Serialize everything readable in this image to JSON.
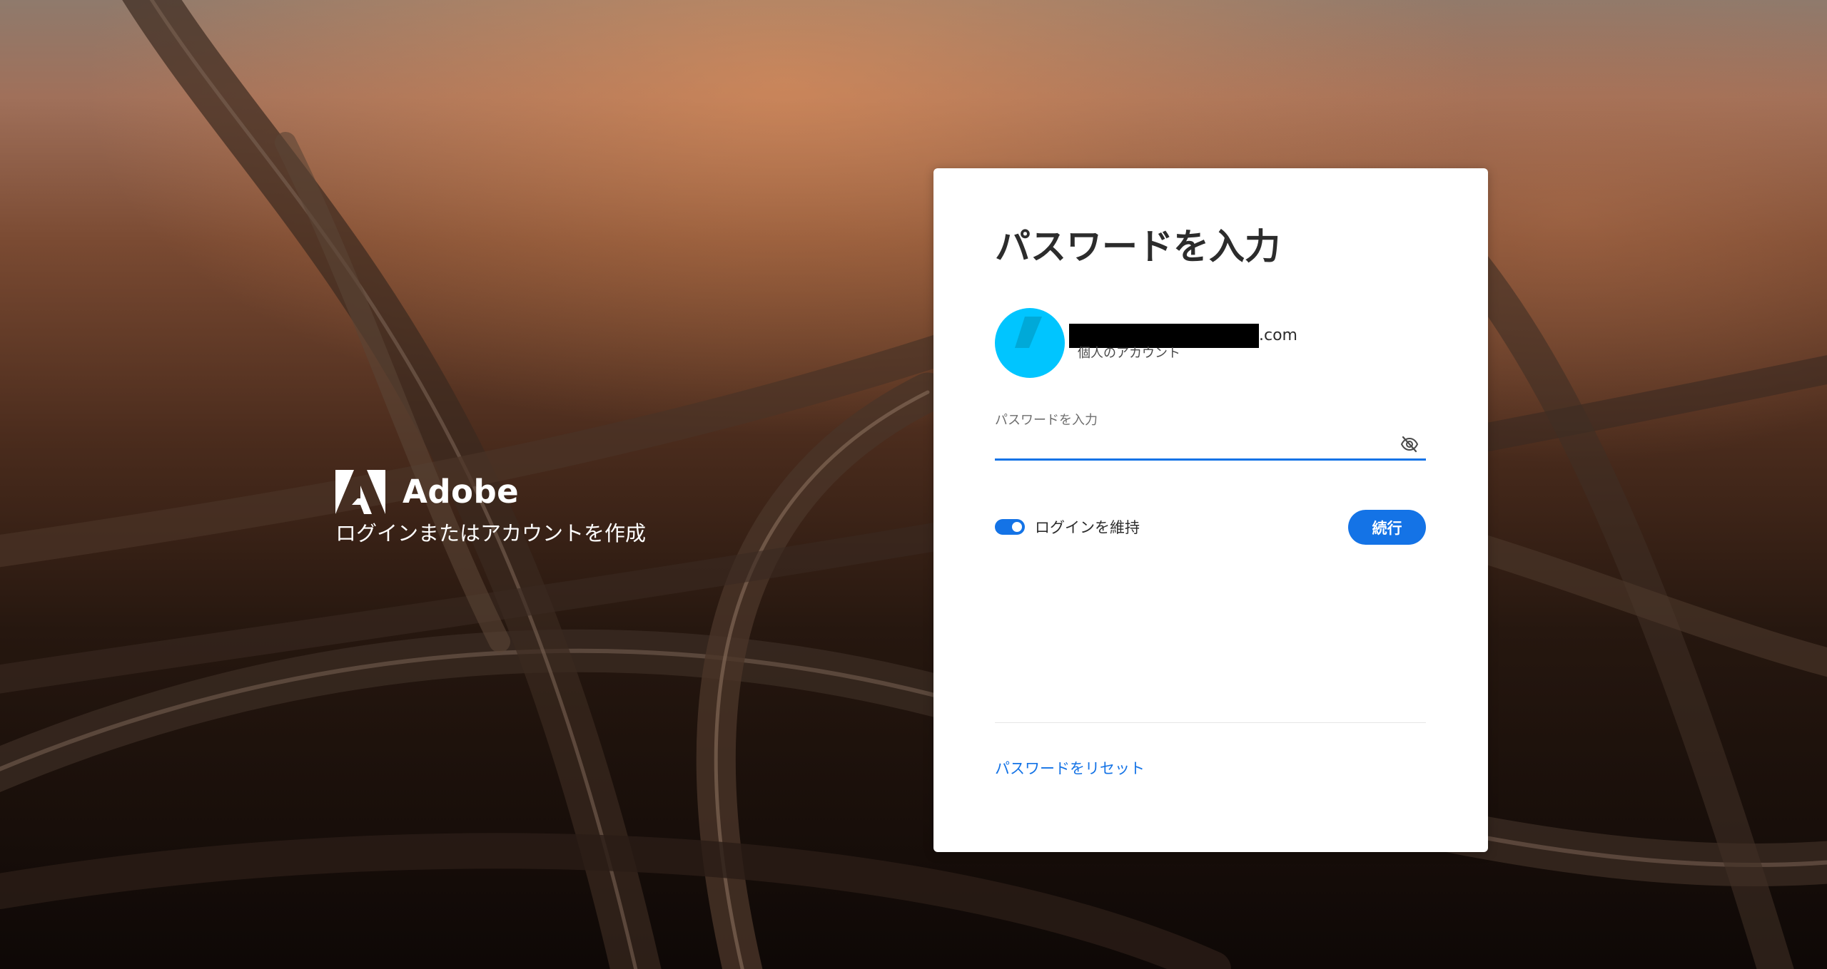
{
  "brand": {
    "name": "Adobe",
    "tagline": "ログインまたはアカウントを作成"
  },
  "card": {
    "title": "パスワードを入力",
    "account": {
      "email_suffix": ".com",
      "type": "個人のアカウント"
    },
    "password": {
      "label": "パスワードを入力",
      "value": ""
    },
    "remember": {
      "label": "ログインを維持",
      "checked": true
    },
    "continue_label": "続行",
    "reset_link": "パスワードをリセット"
  },
  "colors": {
    "accent": "#1473e6",
    "avatar": "#00c5ff",
    "title_text": "#2c2c2c"
  },
  "icons": {
    "brand_logo": "adobe-logo-icon",
    "password_toggle": "eye-off-icon"
  }
}
